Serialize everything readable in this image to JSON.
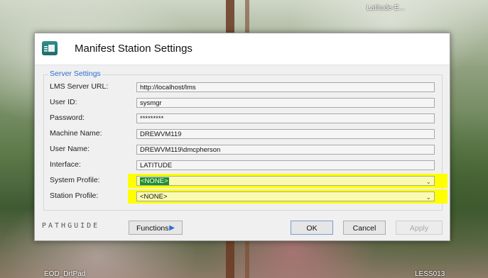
{
  "desktop": {
    "top_right_label": "Latitude-E...",
    "bottom_left_label": "EOD_DrtPad",
    "bottom_right_label": "LESS013"
  },
  "dialog": {
    "title": "Manifest Station Settings",
    "group_legend": "Server Settings",
    "rows": [
      {
        "label": "LMS Server URL:",
        "value": "http://localhost/lms"
      },
      {
        "label": "User ID:",
        "value": "sysmgr"
      },
      {
        "label": "Password:",
        "value": "*********"
      },
      {
        "label": "Machine Name:",
        "value": "DREWVM119"
      },
      {
        "label": "User Name:",
        "value": "DREWVM119\\dmcpherson"
      },
      {
        "label": "Interface:",
        "value": "LATITUDE"
      }
    ],
    "system_profile": {
      "label": "System Profile:",
      "value": "<NONE>"
    },
    "station_profile": {
      "label": "Station Profile:",
      "value": "<NONE>"
    },
    "footer": {
      "logo_text": "PATHGUIDE",
      "functions_label": "Functions",
      "ok_label": "OK",
      "cancel_label": "Cancel",
      "apply_label": "Apply"
    }
  },
  "colors": {
    "highlight": "#ffff00",
    "legend": "#2e6bd2",
    "selection": "#1e8f2a"
  }
}
